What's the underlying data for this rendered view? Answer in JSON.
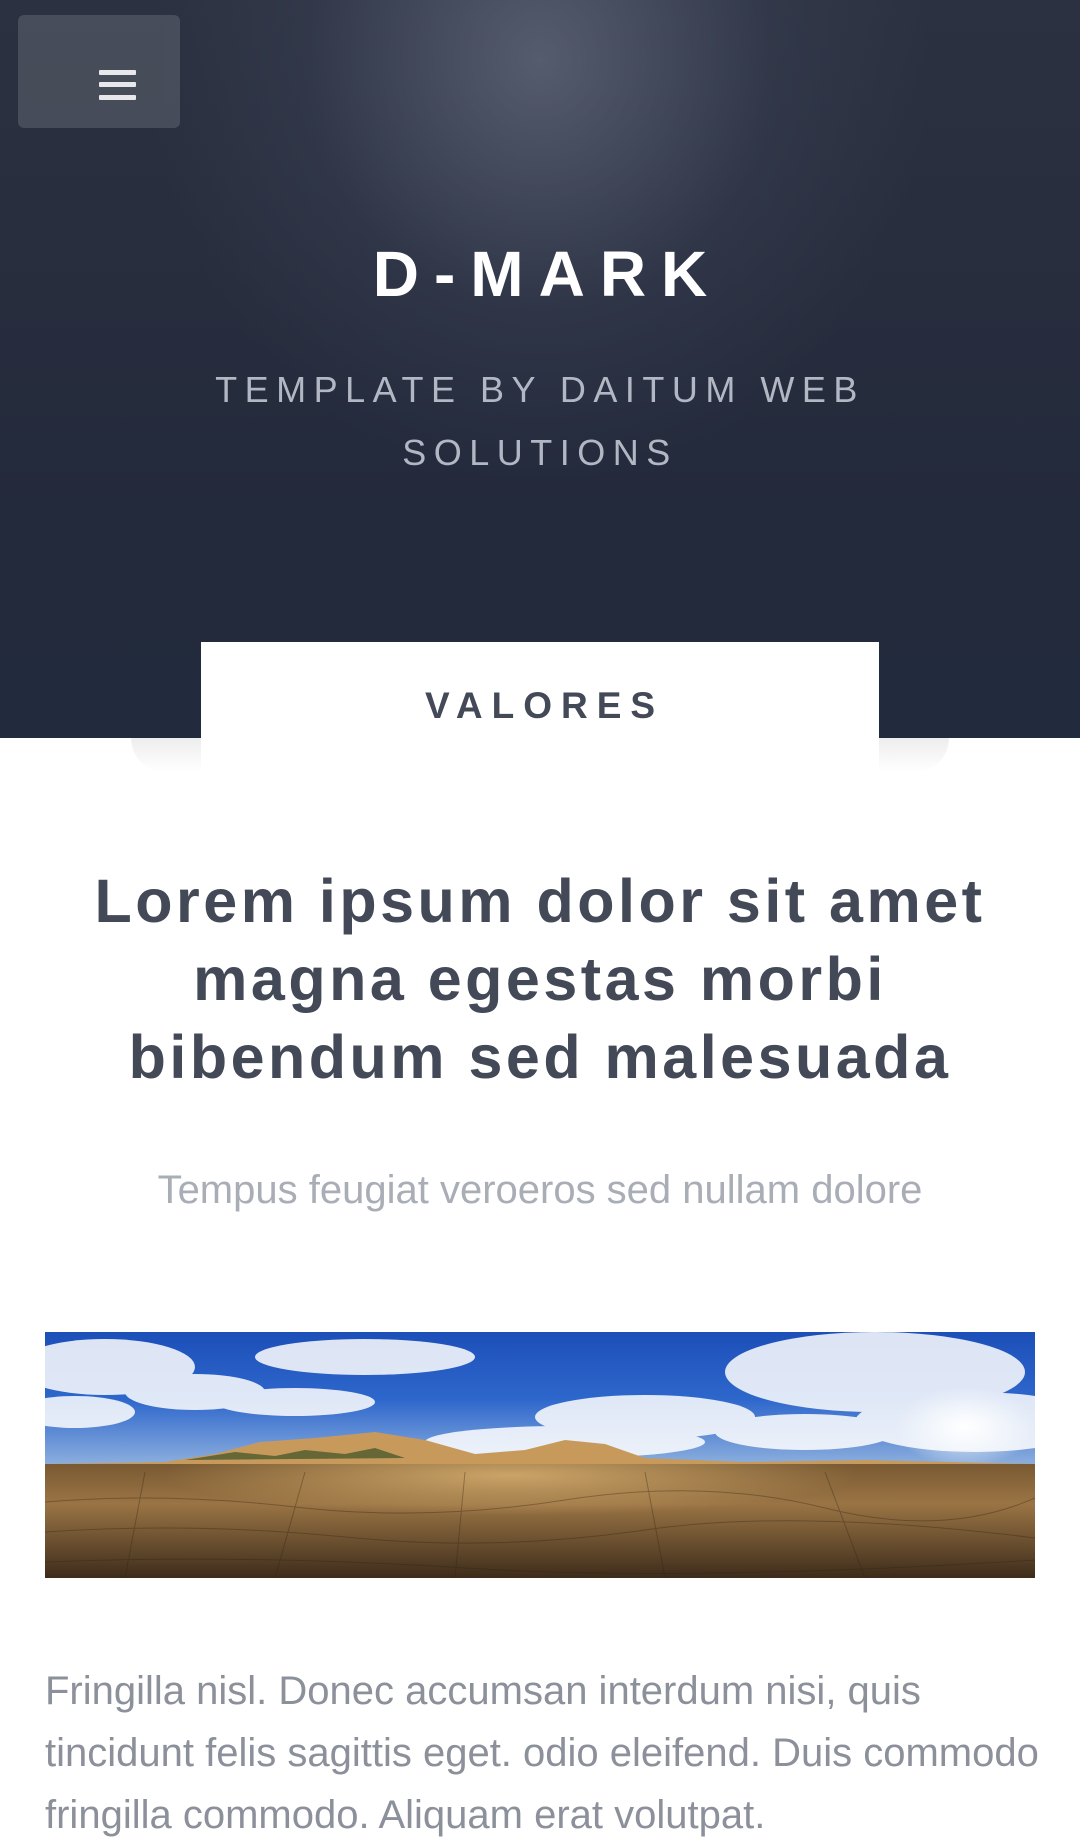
{
  "header": {
    "menu_icon": "hamburger-menu-icon",
    "title": "D-MARK",
    "subtitle": "TEMPLATE BY DAITUM WEB SOLUTIONS"
  },
  "tab": {
    "label": "VALORES"
  },
  "main": {
    "headline": "Lorem ipsum dolor sit amet magna egestas morbi bibendum sed malesuada",
    "lede": "Tempus feugiat veroeros sed nullam dolore",
    "image": "panorama-desert-landscape-image",
    "body": "Fringilla nisl. Donec accumsan interdum nisi, quis tincidunt felis sagittis eget. odio eleifend. Duis commodo fringilla commodo. Aliquam erat volutpat."
  },
  "colors": {
    "hero_bg": "#252b3c",
    "heading_text": "#434957",
    "muted_text": "#a9adb5",
    "body_text": "#8b909a"
  }
}
